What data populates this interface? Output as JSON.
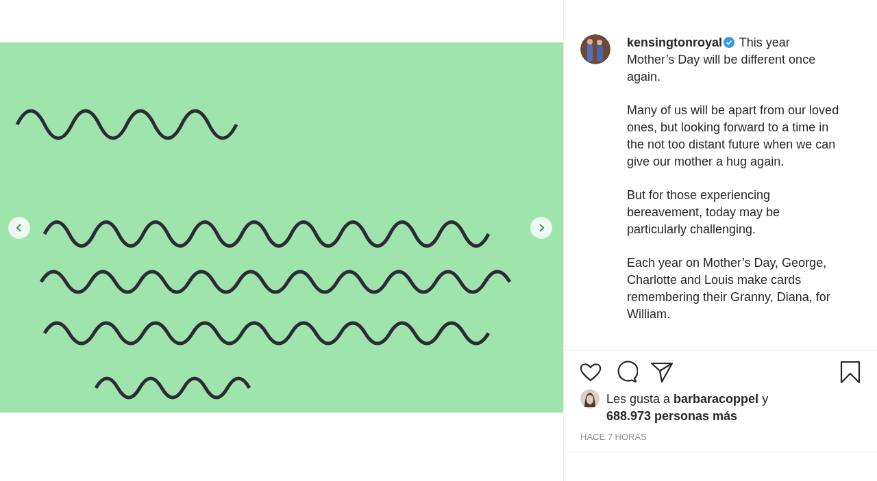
{
  "media": {
    "kind": "picture",
    "has_prev": true,
    "has_next": true
  },
  "caption": {
    "username": "kensingtonroyal",
    "verified": true,
    "paragraphs": [
      "This year Mother’s Day will be different once again.",
      "Many of us will be apart from our loved ones, but looking forward to a time in the not too distant future when we can give our mother a hug again.",
      "But for those experiencing bereavement, today may be particularly challenging.",
      "Each year on Mother’s Day, George, Charlotte and Louis make cards remembering their Granny, Diana, for William."
    ]
  },
  "actions": {
    "liked": false,
    "saved": false
  },
  "likes": {
    "text": "Les gusta a **barbaracoppel** y **688.973 personas más**"
  },
  "time": "HACE 7 HORAS"
}
